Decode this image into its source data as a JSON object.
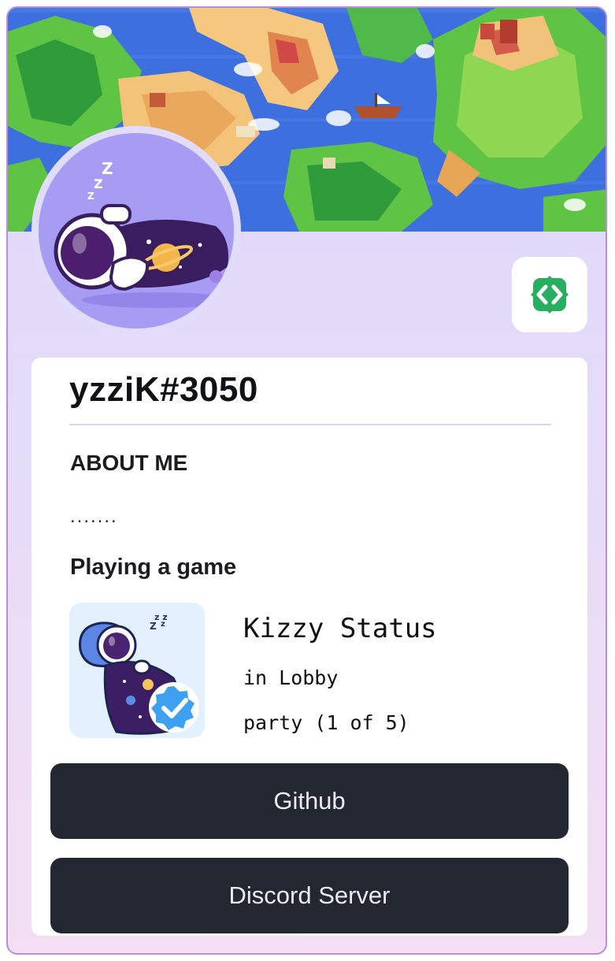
{
  "profile": {
    "username": "yzziK#3050",
    "about_title": "ABOUT ME",
    "about_text": ".......",
    "playing_title": "Playing a game"
  },
  "game": {
    "name": "Kizzy Status",
    "state": "in Lobby",
    "party": "party (1 of 5)"
  },
  "buttons": {
    "github": "Github",
    "discord": "Discord Server"
  },
  "colors": {
    "card_gradient_top": "#dcd6fb",
    "card_gradient_bottom": "#f3def3",
    "button_bg": "#232732",
    "dev_badge": "#27ae60",
    "avatar_bg": "#a79cf3"
  },
  "icons": {
    "dev_badge": "code-brackets-icon",
    "verified": "verified-check-icon"
  }
}
